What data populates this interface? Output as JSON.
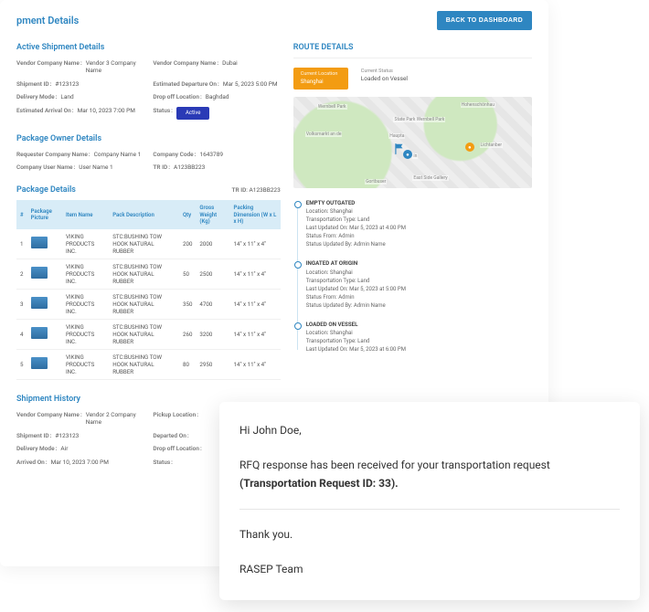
{
  "header": {
    "page_title": "pment Details",
    "back_button": "BACK TO DASHBOARD"
  },
  "active_shipment": {
    "title": "Active Shipment Details",
    "left": {
      "vendor_company_name_label": "Vendor Company Name",
      "vendor_company_name": "Vendor 3 Company Name",
      "shipment_id_label": "Shipment ID",
      "shipment_id": "#123123",
      "delivery_mode_label": "Delivery Mode",
      "delivery_mode": "Land",
      "estimated_arrival_label": "Estimated Arrival On",
      "estimated_arrival": "Mar 10, 2023 7:00 PM"
    },
    "right": {
      "vendor_company_name_label": "Vendor Company Name",
      "vendor_company_name": "Dubai",
      "estimated_departure_label": "Estimated Departure On",
      "estimated_departure": "Mar 5, 2023 5:00 PM",
      "drop_off_label": "Drop off Location",
      "drop_off": "Baghdad",
      "status_label": "Status",
      "status_value": "Active"
    }
  },
  "package_owner": {
    "title": "Package Owner Details",
    "left": {
      "requester_company_label": "Requester Company Name",
      "requester_company": "Company Name 1",
      "company_user_label": "Company User Name",
      "company_user": "User Name 1"
    },
    "right": {
      "company_code_label": "Company Code",
      "company_code": "1643789",
      "tr_id_label": "TR ID",
      "tr_id": "A123BB223"
    }
  },
  "package_details": {
    "title": "Package Details",
    "tr_id_label": "TR ID",
    "tr_id": "A123BB223",
    "columns": {
      "num": "#",
      "picture": "Package Picture",
      "item_name": "Item Name",
      "pack_desc": "Pack Description",
      "qty": "Qty",
      "gross_weight": "Gross Weight (Kg)",
      "packing_dim": "Packing Dimension (W x L x H)"
    },
    "rows": [
      {
        "num": "1",
        "item": "VIKING PRODUCTS INC.",
        "desc": "STC:BUSHING TOW HOOK NATURAL RUBBER",
        "qty": "200",
        "weight": "2000",
        "dim": "14\" x 11\" x 4\""
      },
      {
        "num": "2",
        "item": "VIKING PRODUCTS INC.",
        "desc": "STC:BUSHING TOW HOOK NATURAL RUBBER",
        "qty": "50",
        "weight": "2500",
        "dim": "14\" x 11\" x 4\""
      },
      {
        "num": "3",
        "item": "VIKING PRODUCTS INC.",
        "desc": "STC:BUSHING TOW HOOK NATURAL RUBBER",
        "qty": "350",
        "weight": "4700",
        "dim": "14\" x 11\" x 4\""
      },
      {
        "num": "4",
        "item": "VIKING PRODUCTS INC.",
        "desc": "STC:BUSHING TOW HOOK NATURAL RUBBER",
        "qty": "260",
        "weight": "3200",
        "dim": "14\" x 11\" x 4\""
      },
      {
        "num": "5",
        "item": "VIKING PRODUCTS INC.",
        "desc": "STC:BUSHING TOW HOOK NATURAL RUBBER",
        "qty": "80",
        "weight": "2950",
        "dim": "14\" x 11\" x 4\""
      }
    ]
  },
  "shipment_history": {
    "title": "Shipment History",
    "left": {
      "vendor_company_label": "Vendor Company Name",
      "vendor_company": "Vendor 2 Company Name",
      "shipment_id_label": "Shipment ID",
      "shipment_id": "#123123",
      "delivery_mode_label": "Delivery Mode",
      "delivery_mode": "Air",
      "arrived_on_label": "Arrived On",
      "arrived_on": "Mar 10, 2023 7:00 PM"
    },
    "right": {
      "pickup_location_label": "Pickup Location",
      "departed_on_label": "Departed On",
      "drop_off_label": "Drop off Location",
      "status_label": "Status"
    }
  },
  "route": {
    "title": "ROUTE DETAILS",
    "current_location_label": "Current Location",
    "current_location": "Shanghai",
    "current_status_label": "Current Status",
    "current_status": "Loaded on Vessel",
    "map_labels": {
      "a": "Wernbell Park",
      "b": "State Park Wernbell Park",
      "c": "Hohenschönhau",
      "d": "Haupta",
      "e": "Volksmarkt an de",
      "f": "in",
      "g": "Lichtanber",
      "h": "East Side Gallery",
      "i": "Gortbuser"
    },
    "timeline": [
      {
        "title": "EMPTY OUTGATED",
        "location_label": "Location",
        "location": "Shanghai",
        "type_label": "Transportation Type",
        "type": "Land",
        "updated_label": "Last Updated On",
        "updated": "Mar 5, 2023 at 4:00 PM",
        "status_from_label": "Status From",
        "status_from": "Admin",
        "status_by_label": "Status Updated By",
        "status_by": "Admin Name"
      },
      {
        "title": "INGATED AT ORIGIN",
        "location_label": "Location",
        "location": "Shanghai",
        "type_label": "Transportation Type",
        "type": "Land",
        "updated_label": "Last Updated On",
        "updated": "Mar 5, 2023 at 5:00 PM",
        "status_from_label": "Status From",
        "status_from": "Admin",
        "status_by_label": "Status Updated By",
        "status_by": "Admin Name"
      },
      {
        "title": "LOADED ON VESSEL",
        "location_label": "Location",
        "location": "Shanghai",
        "type_label": "Transportation Type",
        "type": "Land",
        "updated_label": "Last Updated On",
        "updated": "Mar 5, 2023 at 6:00 PM"
      }
    ]
  },
  "email": {
    "greeting": "Hi John Doe,",
    "body_prefix": "RFQ response has been received for your transportation request ",
    "body_bold": "(Transportation Request ID: 33).",
    "thanks": "Thank you.",
    "sign": "RASEP Team"
  }
}
